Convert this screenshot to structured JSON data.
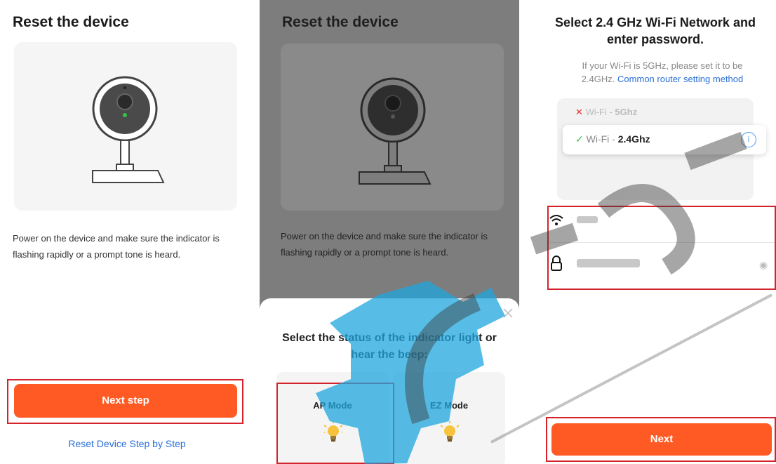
{
  "screen1": {
    "title": "Reset the device",
    "instruction": "Power on the device and make sure the indicator is flashing rapidly or a prompt tone is heard.",
    "next_button": "Next step",
    "help_link": "Reset Device Step by Step"
  },
  "screen2": {
    "title": "Reset the device",
    "instruction": "Power on the device and make sure the indicator is flashing rapidly or a prompt tone is heard.",
    "sheet_title": "Select the status of the indicator light or hear the beep:",
    "modes": [
      "AP Mode",
      "EZ Mode"
    ]
  },
  "screen3": {
    "title": "Select 2.4 GHz Wi-Fi Network and enter password.",
    "note": "If your Wi-Fi is 5GHz, please set it to be 2.4GHz.",
    "note_link": "Common router setting method",
    "wifi_options": [
      {
        "prefix": "Wi-Fi - ",
        "band": "5Ghz",
        "status": "invalid"
      },
      {
        "prefix": "Wi-Fi - ",
        "band": "2.4Ghz",
        "status": "valid"
      }
    ],
    "next_button": "Next"
  },
  "colors": {
    "accent": "#ff5a24",
    "highlight": "#d4232a",
    "link": "#2a6fd6"
  }
}
